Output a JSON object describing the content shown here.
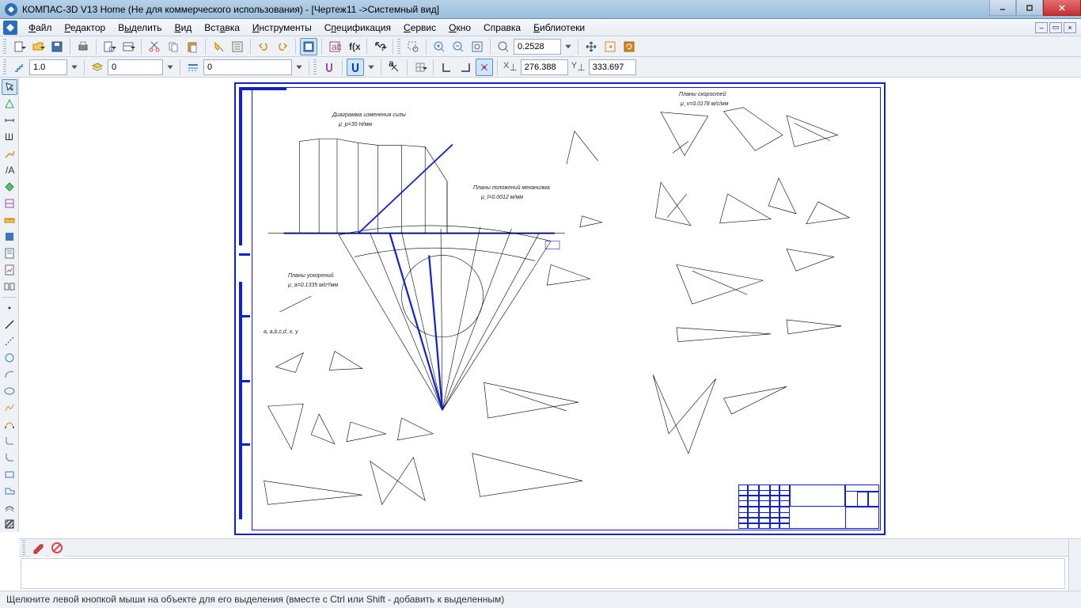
{
  "title": "КОМПАС-3D V13 Home (Не для коммерческого использования) - [Чертеж11 ->Системный вид]",
  "menu": {
    "file": "Файл",
    "editor": "Редактор",
    "select": "Выделить",
    "view": "Вид",
    "insert": "Вставка",
    "tools": "Инструменты",
    "spec": "Спецификация",
    "service": "Сервис",
    "window": "Окно",
    "help": "Справка",
    "libs": "Библиотеки"
  },
  "toolbar1": {
    "zoom": "0.2528"
  },
  "toolbar2": {
    "val1": "1.0",
    "val2": "0",
    "val3": "0",
    "coord_x": "276.388",
    "coord_y": "333.697"
  },
  "drawing": {
    "section1": "Диаграмма изменения силы",
    "section1_scale": "μ_p=30 Н/мм",
    "section2": "Планы положений механизма",
    "section2_scale": "μ_l=0.0012 м/мм",
    "section3": "Планы ускорений",
    "section3_scale": "μ_a=0.1335 м/с²/мм",
    "section4": "Планы скоростей",
    "section4_scale": "μ_v=0.0178 м/с/мм",
    "points": "a, a,b,c,d, x, y"
  },
  "status": "Щелкните левой кнопкой мыши на объекте для его выделения (вместе с Ctrl или Shift - добавить к выделенным)"
}
